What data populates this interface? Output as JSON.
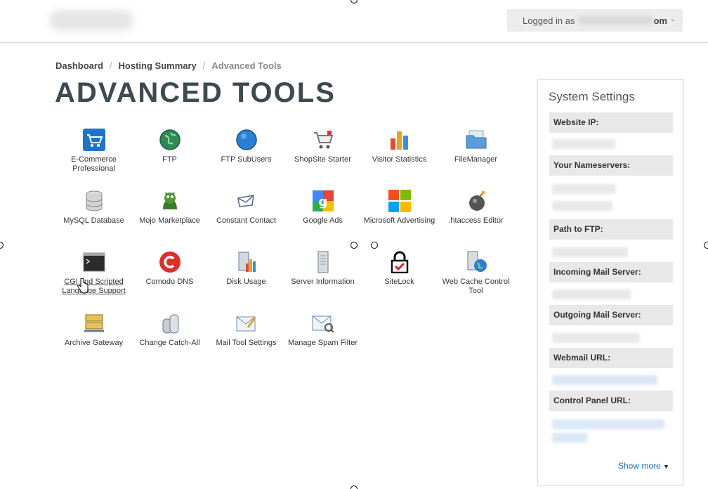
{
  "header": {
    "logged_in_label": "Logged in as",
    "logged_in_tail": "om"
  },
  "breadcrumb": {
    "items": [
      "Dashboard",
      "Hosting Summary",
      "Advanced Tools"
    ],
    "separator": "/"
  },
  "page_title": "ADVANCED TOOLS",
  "tools": [
    {
      "label": "E-Commerce Professional",
      "icon": "shopping-cart-icon"
    },
    {
      "label": "FTP",
      "icon": "globe-icon"
    },
    {
      "label": "FTP SubUsers",
      "icon": "blue-sphere-icon"
    },
    {
      "label": "ShopSite Starter",
      "icon": "cart-icon"
    },
    {
      "label": "Visitor Statistics",
      "icon": "bar-chart-icon"
    },
    {
      "label": "FileManager",
      "icon": "folder-icon"
    },
    {
      "label": "MySQL Database",
      "icon": "database-icon"
    },
    {
      "label": "Mojo Marketplace",
      "icon": "mojo-monster-icon"
    },
    {
      "label": "Constant Contact",
      "icon": "envelope-icon"
    },
    {
      "label": "Google Ads",
      "icon": "google-ads-icon"
    },
    {
      "label": "Microsoft Advertising",
      "icon": "microsoft-icon"
    },
    {
      "label": ".htaccess Editor",
      "icon": "bomb-icon"
    },
    {
      "label": "CGI and Scripted Language Support",
      "icon": "terminal-icon"
    },
    {
      "label": "Comodo DNS",
      "icon": "comodo-icon"
    },
    {
      "label": "Disk Usage",
      "icon": "disk-usage-icon"
    },
    {
      "label": "Server Information",
      "icon": "server-icon"
    },
    {
      "label": "SiteLock",
      "icon": "padlock-icon"
    },
    {
      "label": "Web Cache Control Tool",
      "icon": "web-cache-icon"
    },
    {
      "label": "Archive Gateway",
      "icon": "archive-icon"
    },
    {
      "label": "Change Catch-All",
      "icon": "catch-all-icon"
    },
    {
      "label": "Mail Tool Settings",
      "icon": "mail-settings-icon"
    },
    {
      "label": "Manage Spam Filter",
      "icon": "spam-filter-icon"
    }
  ],
  "sidebar": {
    "title": "System Settings",
    "labels": [
      "Website IP:",
      "Your Nameservers:",
      "Path to FTP:",
      "Incoming Mail Server:",
      "Outgoing Mail Server:",
      "Webmail URL:",
      "Control Panel URL:"
    ],
    "show_more": "Show more"
  },
  "colors": {
    "title": "#3d4a50",
    "link": "#1a6fb5",
    "label_bg": "#e8e8e8"
  }
}
